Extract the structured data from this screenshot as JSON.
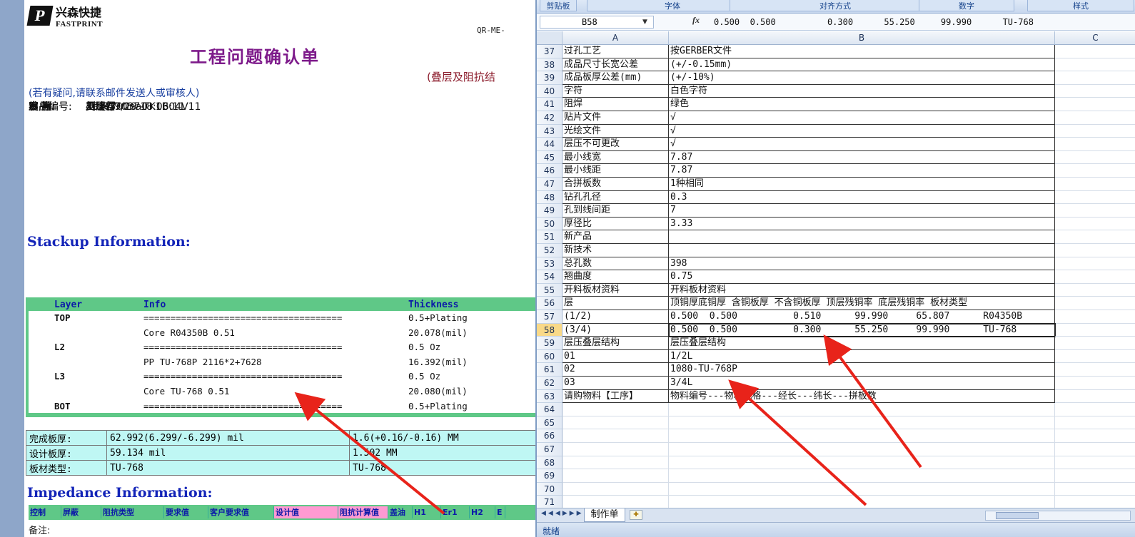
{
  "document": {
    "logo": {
      "mark": "P",
      "cn": "兴森快捷",
      "en": "FASTPRINT"
    },
    "qr_code": "QR-ME-",
    "title": "工程问题确认单",
    "subtitle": "(叠层及阻抗结",
    "note": "(若有疑问,请联系邮件发送人或审核人)",
    "meta": [
      {
        "key": "发    自:",
        "value": "工程部"
      },
      {
        "key": "编    写:",
        "value": "吴洁君"
      },
      {
        "key": "审    核:",
        "value": "刘涛"
      },
      {
        "key": "产品编号:",
        "value": "4c1e700na0"
      },
      {
        "key": "客户编号:",
        "value": "XR.P17037-TK1B04V11"
      },
      {
        "key": "日    期:",
        "value": "2017/9/29 18:06:11"
      }
    ],
    "stackup_heading": "Stackup Information:",
    "stackup_headers": {
      "layer": "Layer",
      "info": "Info",
      "thickness": "Thickness"
    },
    "stackup_rows": [
      {
        "layer": "TOP",
        "info": "=====================================",
        "thickness": "0.5+Plating"
      },
      {
        "layer": "",
        "info": "Core     R04350B    0.51",
        "thickness": "20.078(mil)"
      },
      {
        "layer": "L2",
        "info": "=====================================",
        "thickness": "0.5 Oz"
      },
      {
        "layer": "",
        "info": "PP     TU-768P    2116*2+7628",
        "thickness": "16.392(mil)"
      },
      {
        "layer": "L3",
        "info": "=====================================",
        "thickness": "0.5 Oz"
      },
      {
        "layer": "",
        "info": "Core     TU-768    0.51",
        "thickness": "20.080(mil)"
      },
      {
        "layer": "BOT",
        "info": "=====================================",
        "thickness": "0.5+Plating"
      }
    ],
    "board_rows": [
      {
        "label": "完成板厚:",
        "mil": "62.992(6.299/-6.299) mil",
        "mm": "1.6(+0.16/-0.16) MM"
      },
      {
        "label": "设计板厚:",
        "mil": "59.134 mil",
        "mm": "1.502 MM"
      },
      {
        "label": "板材类型:",
        "mil": "TU-768",
        "mm": "TU-768"
      }
    ],
    "impedance_heading": "Impedance Information:",
    "impedance_headers": [
      "控制",
      "屏蔽",
      "阻抗类型",
      "要求值",
      "客户要求值",
      "设计值",
      "阻抗计算值",
      "盖油",
      "H1",
      "Er1",
      "H2",
      "E"
    ],
    "remark": "备注:"
  },
  "excel": {
    "ribbon_groups": [
      "剪贴板",
      "字体",
      "对齐方式",
      "数字",
      "样式"
    ],
    "name_box": "B58",
    "fx_label": "fx",
    "formula": "0.500  0.500          0.300      55.250     99.990      TU-768",
    "columns": [
      "A",
      "B",
      "C"
    ],
    "rows": [
      {
        "n": "37",
        "a": "过孔工艺",
        "b": "按GERBER文件"
      },
      {
        "n": "38",
        "a": "成品尺寸长宽公差",
        "b": "(+/-0.15mm)"
      },
      {
        "n": "39",
        "a": "成品板厚公差(mm)",
        "b": "(+/-10%)"
      },
      {
        "n": "40",
        "a": "字符",
        "b": "白色字符"
      },
      {
        "n": "41",
        "a": "阻焊",
        "b": "绿色"
      },
      {
        "n": "42",
        "a": "贴片文件",
        "b": "√"
      },
      {
        "n": "43",
        "a": "光绘文件",
        "b": "√"
      },
      {
        "n": "44",
        "a": "层压不可更改",
        "b": "√"
      },
      {
        "n": "45",
        "a": "最小线宽",
        "b": "7.87"
      },
      {
        "n": "46",
        "a": "最小线距",
        "b": "7.87"
      },
      {
        "n": "47",
        "a": "合拼板数",
        "b": "1种相同"
      },
      {
        "n": "48",
        "a": "钻孔孔径",
        "b": "0.3"
      },
      {
        "n": "49",
        "a": "孔到线间距",
        "b": "7"
      },
      {
        "n": "50",
        "a": "厚径比",
        "b": "3.33"
      },
      {
        "n": "51",
        "a": "新产品",
        "b": ""
      },
      {
        "n": "52",
        "a": "新技术",
        "b": ""
      },
      {
        "n": "53",
        "a": "总孔数",
        "b": "398"
      },
      {
        "n": "54",
        "a": "翘曲度",
        "b": "0.75"
      },
      {
        "n": "55",
        "a": "开料板材资料",
        "b": "开料板材资料"
      },
      {
        "n": "56",
        "a": "层",
        "b": "顶铜厚底铜厚 含铜板厚 不含铜板厚 顶层残铜率 底层残铜率 板材类型"
      },
      {
        "n": "57",
        "a": "(1/2)",
        "b": "0.500  0.500          0.510      99.990     65.807      R04350B"
      },
      {
        "n": "58",
        "a": "(3/4)",
        "b": "0.500  0.500          0.300      55.250     99.990      TU-768"
      },
      {
        "n": "59",
        "a": "层压叠层结构",
        "b": "层压叠层结构"
      },
      {
        "n": "60",
        "a": "01",
        "b": "1/2L"
      },
      {
        "n": "61",
        "a": "02",
        "b": "1080-TU-768P"
      },
      {
        "n": "62",
        "a": "03",
        "b": "3/4L"
      },
      {
        "n": "63",
        "a": "请购物料【工序】",
        "b": "物料编号---物料规格---经长---纬长---拼板数"
      },
      {
        "n": "64",
        "a": "",
        "b": ""
      },
      {
        "n": "65",
        "a": "",
        "b": ""
      },
      {
        "n": "66",
        "a": "",
        "b": ""
      },
      {
        "n": "67",
        "a": "",
        "b": ""
      },
      {
        "n": "68",
        "a": "",
        "b": ""
      },
      {
        "n": "69",
        "a": "",
        "b": ""
      },
      {
        "n": "70",
        "a": "",
        "b": ""
      },
      {
        "n": "71",
        "a": "",
        "b": ""
      }
    ],
    "selected_row": "58",
    "sheet_tab": "制作单",
    "status": "就绪"
  }
}
